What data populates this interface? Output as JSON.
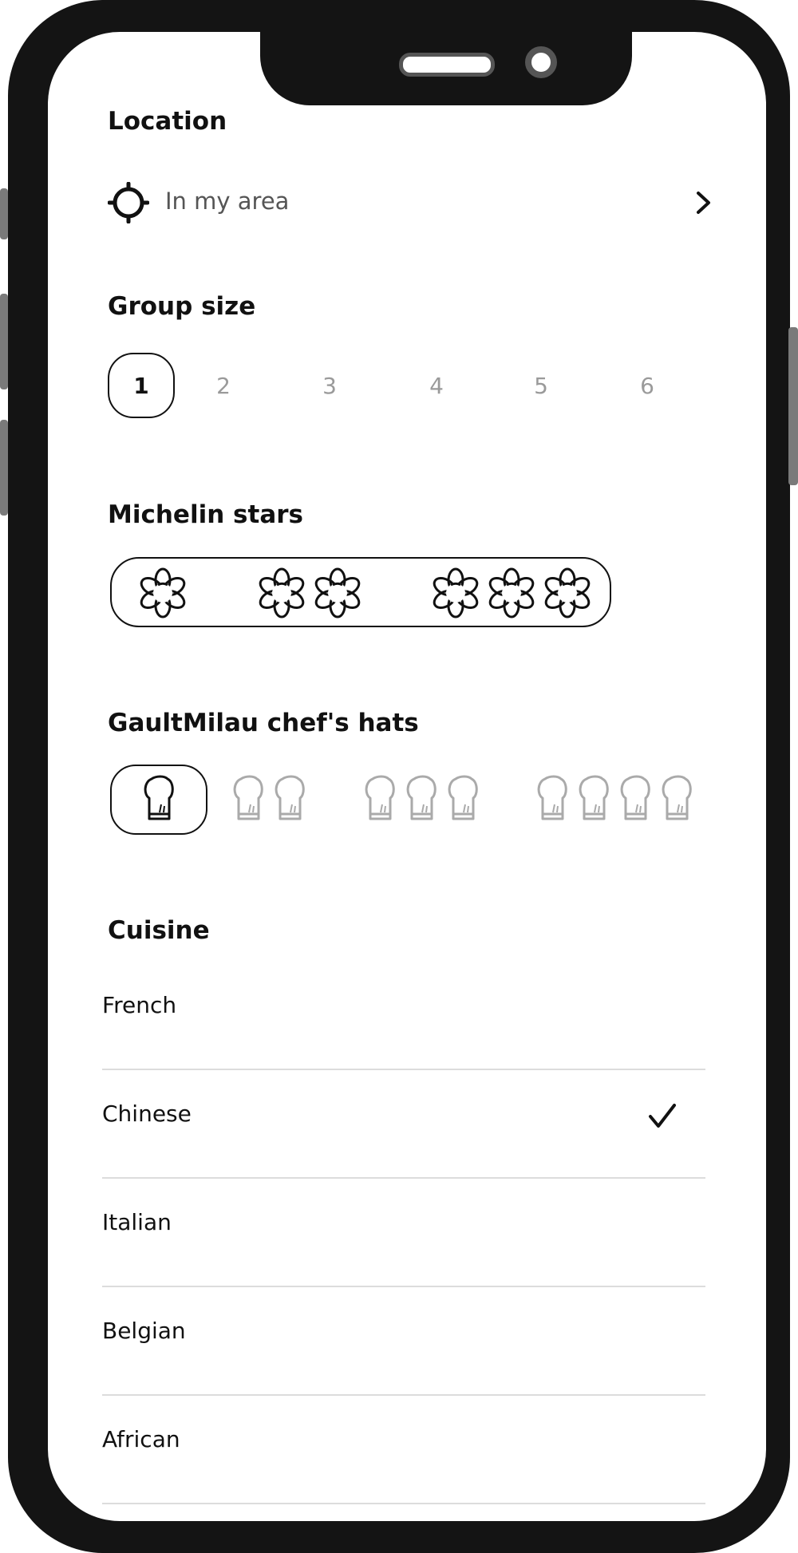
{
  "location": {
    "heading": "Location",
    "value": "In my area",
    "icon": "crosshair-icon"
  },
  "group_size": {
    "heading": "Group size",
    "options": [
      "1",
      "2",
      "3",
      "4",
      "5",
      "6"
    ],
    "selected": "1"
  },
  "michelin": {
    "heading": "Michelin stars",
    "options": [
      1,
      2,
      3
    ],
    "icon": "michelin-star-icon"
  },
  "gaultmillau": {
    "heading": "GaultMilau chef's hats",
    "options": [
      1,
      2,
      3,
      4
    ],
    "selected": 1,
    "icon": "chef-hat-icon"
  },
  "cuisine": {
    "heading": "Cuisine",
    "items": [
      {
        "label": "French",
        "checked": false
      },
      {
        "label": "Chinese",
        "checked": true
      },
      {
        "label": "Italian",
        "checked": false
      },
      {
        "label": "Belgian",
        "checked": false
      },
      {
        "label": "African",
        "checked": false
      }
    ]
  },
  "colors": {
    "text": "#111111",
    "muted": "#9a9a9a",
    "divider": "#dcdcdc",
    "frame": "#141414"
  }
}
